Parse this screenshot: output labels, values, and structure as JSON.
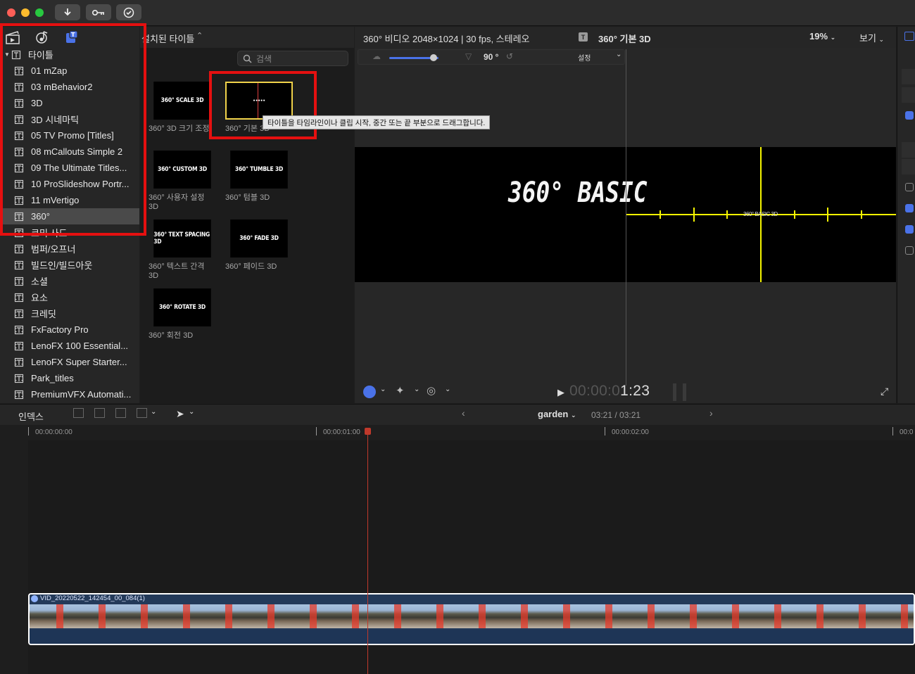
{
  "sidebar": {
    "root_label": "타이틀",
    "items": [
      {
        "label": "01 mZap"
      },
      {
        "label": "03 mBehavior2"
      },
      {
        "label": "3D"
      },
      {
        "label": "3D 시네마틱"
      },
      {
        "label": "05 TV Promo [Titles]"
      },
      {
        "label": "08 mCallouts Simple 2"
      },
      {
        "label": "09 The Ultimate Titles..."
      },
      {
        "label": "10 ProSlideshow Portr..."
      },
      {
        "label": "11 mVertigo"
      },
      {
        "label": "360°"
      },
      {
        "label": "코믹 사드"
      },
      {
        "label": "범퍼/오프너"
      },
      {
        "label": "빌드인/빌드아웃"
      },
      {
        "label": "소셜"
      },
      {
        "label": "요소"
      },
      {
        "label": "크레딧"
      },
      {
        "label": "FxFactory Pro"
      },
      {
        "label": "LenoFX 100 Essential..."
      },
      {
        "label": "LenoFX Super Starter..."
      },
      {
        "label": "Park_titles"
      },
      {
        "label": "PremiumVFX Automati..."
      }
    ]
  },
  "browser": {
    "header": "설치된 타이틀",
    "search_placeholder": "검색",
    "thumbs": [
      {
        "thumb_text": "360° SCALE 3D",
        "label": "360° 3D 크기 조정"
      },
      {
        "thumb_text": "",
        "label": "360° 기본 3D"
      },
      {
        "thumb_text": "360° CUSTOM 3D",
        "label": "360° 사용자 설정 3D"
      },
      {
        "thumb_text": "360° TUMBLE 3D",
        "label": "360° 텀블 3D"
      },
      {
        "thumb_text": "360° TEXT SPACING 3D",
        "label": "360° 텍스트 간격 3D"
      },
      {
        "thumb_text": "360° FADE 3D",
        "label": "360° 페이드 3D"
      },
      {
        "thumb_text": "360° ROTATE 3D",
        "label": "360° 회전 3D"
      }
    ],
    "tooltip": "타이틀을 타임라인이나 클립 시작, 중간 또는 끝 부분으로 드래그합니다."
  },
  "viewer": {
    "format": "360° 비디오 2048×1024 | 30 fps, 스테레오",
    "clip_title": "360° 기본 3D",
    "zoom": "19%",
    "view_menu": "보기",
    "angle": "90 °",
    "settings": "설정",
    "title_text": "360° BASIC",
    "preview_label": "360° BASIC 3D",
    "timecode_dim": "00:00:0",
    "timecode_bright": "1:23"
  },
  "timeline": {
    "index_label": "인덱스",
    "project_name": "garden",
    "duration": "03:21 / 03:21",
    "ruler": [
      "00:00:00:00",
      "00:00:01:00",
      "00:00:02:00",
      "00:0"
    ],
    "clip_name": "VID_20220522_142454_00_084(1)"
  },
  "colors": {
    "highlight_box": "#e51010",
    "accent": "#4a72e8",
    "playhead": "#c0392b",
    "guide": "#f5f500"
  }
}
